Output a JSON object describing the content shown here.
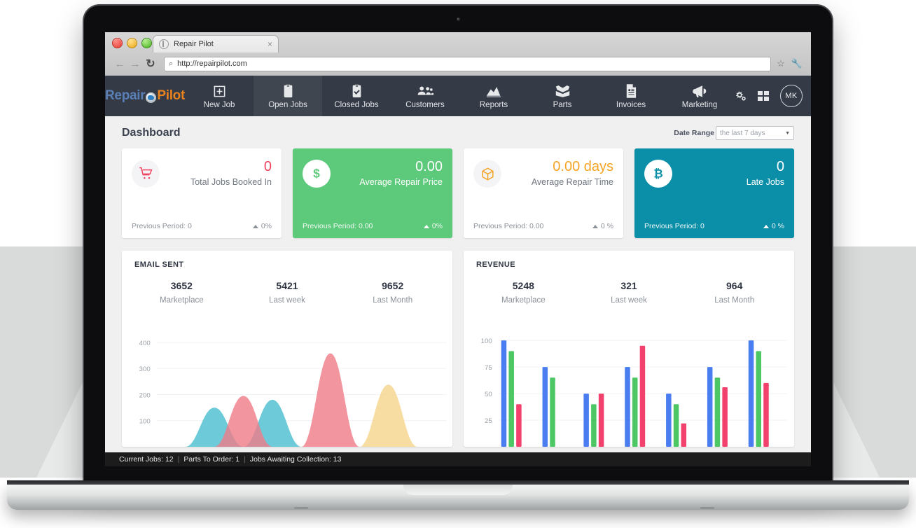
{
  "browser": {
    "tab_title": "Repair Pilot",
    "tab_close": "×",
    "back_icon": "←",
    "forward_icon": "→",
    "reload_icon": "↻",
    "url_search_icon": "⌕",
    "url": "http://repairpilot.com",
    "star_icon": "☆",
    "wrench_icon": "🔧"
  },
  "appnav": {
    "logo_first": "Repair",
    "logo_second": "Pilot",
    "items": [
      {
        "label": "New Job",
        "icon": "plus-square-icon",
        "active": false
      },
      {
        "label": "Open Jobs",
        "icon": "clipboard-list-icon",
        "active": true
      },
      {
        "label": "Closed Jobs",
        "icon": "clipboard-check-icon",
        "active": false
      },
      {
        "label": "Customers",
        "icon": "users-icon",
        "active": false
      },
      {
        "label": "Reports",
        "icon": "area-chart-icon",
        "active": false
      },
      {
        "label": "Parts",
        "icon": "open-box-icon",
        "active": false
      },
      {
        "label": "Invoices",
        "icon": "invoice-doc-icon",
        "active": false
      },
      {
        "label": "Marketing",
        "icon": "megaphone-icon",
        "active": false
      }
    ],
    "settings_icon": "gears-icon",
    "grid_icon": "grid-apps-icon",
    "avatar_initials": "MK"
  },
  "page": {
    "title": "Dashboard",
    "date_range_label": "Date Range",
    "date_range_value": "the last 7 days",
    "date_range_caret": "▼"
  },
  "cards": [
    {
      "icon": "shopping-cart-icon",
      "value": "0",
      "label": "Total Jobs Booked In",
      "previous": "Previous Period: 0",
      "delta": "0%",
      "theme": "white",
      "accent": "#f0425e"
    },
    {
      "icon": "dollar-sign-icon",
      "value": "0.00",
      "label": "Average Repair Price",
      "previous": "Previous Period: 0.00",
      "delta": "0%",
      "theme": "green",
      "accent": "#5cc97b"
    },
    {
      "icon": "cube-box-icon",
      "value": "0.00 days",
      "label": "Average Repair Time",
      "previous": "Previous Period: 0.00",
      "delta": "0 %",
      "theme": "white-orange",
      "accent": "#f6a424"
    },
    {
      "icon": "bitcoin-icon",
      "value": "0",
      "label": "Late Jobs",
      "previous": "Previous Period: 0",
      "delta": "0 %",
      "theme": "teal",
      "accent": "#0b8fa8"
    }
  ],
  "panels": [
    {
      "title": "EMAIL SENT",
      "stats": [
        {
          "num": "3652",
          "label": "Marketplace"
        },
        {
          "num": "5421",
          "label": "Last week"
        },
        {
          "num": "9652",
          "label": "Last Month"
        }
      ]
    },
    {
      "title": "REVENUE",
      "stats": [
        {
          "num": "5248",
          "label": "Marketplace"
        },
        {
          "num": "321",
          "label": "Last week"
        },
        {
          "num": "964",
          "label": "Last Month"
        }
      ]
    }
  ],
  "chart_data": [
    {
      "type": "area",
      "title": "EMAIL SENT",
      "xlabel": "",
      "ylabel": "",
      "ylim": [
        0,
        440
      ],
      "yticks": [
        100,
        200,
        300,
        400
      ],
      "grid": true,
      "legend": "none",
      "x": [
        0,
        1,
        2,
        3,
        4,
        5,
        6,
        7,
        8,
        9,
        10
      ],
      "series": [
        {
          "name": "series-teal",
          "color": "#49bed0",
          "values": [
            0,
            0,
            150,
            0,
            180,
            0,
            0,
            0,
            0,
            0,
            0
          ]
        },
        {
          "name": "series-pink",
          "color": "#ef7b87",
          "values": [
            0,
            0,
            0,
            195,
            0,
            0,
            358,
            0,
            0,
            0,
            0
          ]
        },
        {
          "name": "series-yellow",
          "color": "#f6d48c",
          "values": [
            0,
            0,
            0,
            0,
            0,
            0,
            0,
            0,
            238,
            0,
            0
          ]
        }
      ]
    },
    {
      "type": "bar",
      "title": "REVENUE",
      "xlabel": "",
      "ylabel": "",
      "ylim": [
        0,
        108
      ],
      "yticks": [
        25,
        50,
        75,
        100
      ],
      "grid": true,
      "legend": "none",
      "categories": [
        "1",
        "2",
        "3",
        "4",
        "5",
        "6",
        "7"
      ],
      "series": [
        {
          "name": "blue",
          "color": "#4a7ef0",
          "values": [
            100,
            75,
            50,
            75,
            50,
            75,
            100
          ]
        },
        {
          "name": "green",
          "color": "#4fc job",
          "values": [
            90,
            65,
            40,
            65,
            40,
            65,
            90
          ]
        },
        {
          "name": "pink",
          "color": "#f1416c",
          "values": [
            40,
            0,
            50,
            95,
            22,
            56,
            60
          ]
        }
      ]
    }
  ],
  "statusbar": {
    "current_jobs": "Current Jobs: 12",
    "sep1": "|",
    "parts_to_order": "Parts To Order: 1",
    "sep2": "|",
    "jobs_awaiting": "Jobs Awaiting Collection: 13"
  }
}
